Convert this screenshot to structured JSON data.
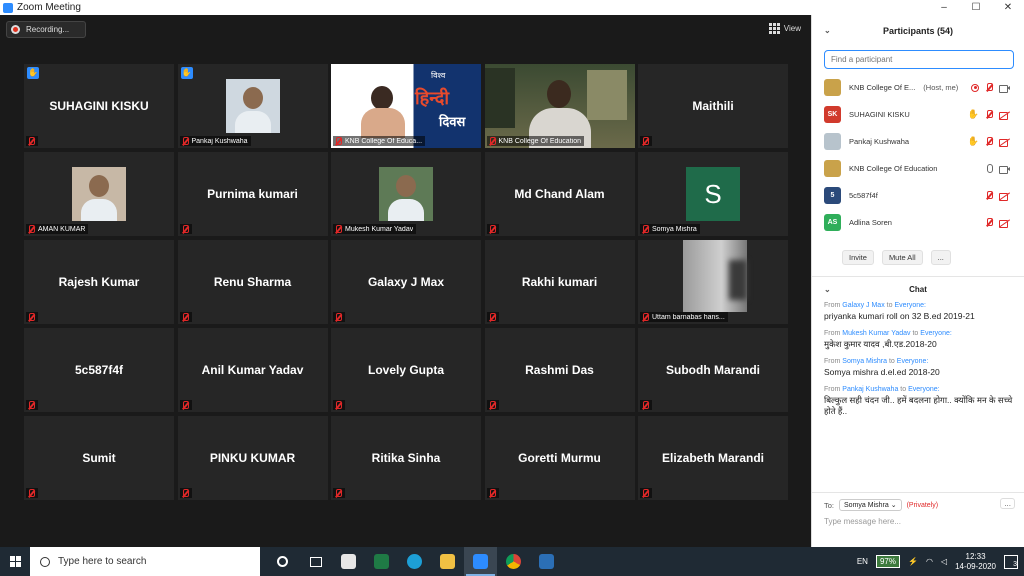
{
  "window": {
    "title": "Zoom Meeting",
    "minimize": "–",
    "maximize": "☐",
    "close": "✕"
  },
  "stage": {
    "recording_label": "Recording...",
    "view_label": "View",
    "tiles": [
      {
        "name": "SUHAGINI KISKU",
        "label": "",
        "hand": true,
        "active": false,
        "kind": "name"
      },
      {
        "name": "",
        "label": "Pankaj Kushwaha",
        "hand": true,
        "active": false,
        "kind": "photo",
        "photo_color": "#cfd8e0"
      },
      {
        "name": "",
        "label": "KNB College Of Educa...",
        "hand": false,
        "active": false,
        "kind": "hindi",
        "hindi_line1": "विश्व",
        "hindi_line2": "हिन्दी",
        "hindi_line3": "दिवस"
      },
      {
        "name": "",
        "label": "KNB College Of Education",
        "hand": false,
        "active": true,
        "kind": "video"
      },
      {
        "name": "Maithili",
        "label": "",
        "hand": false,
        "active": false,
        "kind": "name"
      },
      {
        "name": "",
        "label": "AMAN KUMAR",
        "hand": false,
        "active": false,
        "kind": "photo",
        "photo_color": "#c7b8a6"
      },
      {
        "name": "Purnima kumari",
        "label": "",
        "hand": false,
        "active": false,
        "kind": "name"
      },
      {
        "name": "",
        "label": "Mukesh Kumar Yadav",
        "hand": false,
        "active": false,
        "kind": "photo",
        "photo_color": "#5e7a56"
      },
      {
        "name": "Md Chand Alam",
        "label": "",
        "hand": false,
        "active": false,
        "kind": "name"
      },
      {
        "name": "",
        "label": "Somya Mishra",
        "hand": false,
        "active": false,
        "kind": "avatar",
        "initial": "S"
      },
      {
        "name": "Rajesh Kumar",
        "label": "",
        "hand": false,
        "active": false,
        "kind": "name"
      },
      {
        "name": "Renu Sharma",
        "label": "",
        "hand": false,
        "active": false,
        "kind": "name"
      },
      {
        "name": "Galaxy J Max",
        "label": "",
        "hand": false,
        "active": false,
        "kind": "name"
      },
      {
        "name": "Rakhi kumari",
        "label": "",
        "hand": false,
        "active": false,
        "kind": "name"
      },
      {
        "name": "",
        "label": "Uttam barnabas hans...",
        "hand": false,
        "active": false,
        "kind": "blurry"
      },
      {
        "name": "5c587f4f",
        "label": "",
        "hand": false,
        "active": false,
        "kind": "name"
      },
      {
        "name": "Anil Kumar Yadav",
        "label": "",
        "hand": false,
        "active": false,
        "kind": "name"
      },
      {
        "name": "Lovely Gupta",
        "label": "",
        "hand": false,
        "active": false,
        "kind": "name"
      },
      {
        "name": "Rashmi Das",
        "label": "",
        "hand": false,
        "active": false,
        "kind": "name"
      },
      {
        "name": "Subodh Marandi",
        "label": "",
        "hand": false,
        "active": false,
        "kind": "name"
      },
      {
        "name": "Sumit",
        "label": "",
        "hand": false,
        "active": false,
        "kind": "name"
      },
      {
        "name": "PINKU KUMAR",
        "label": "",
        "hand": false,
        "active": false,
        "kind": "name"
      },
      {
        "name": "Ritika Sinha",
        "label": "",
        "hand": false,
        "active": false,
        "kind": "name"
      },
      {
        "name": "Goretti Murmu",
        "label": "",
        "hand": false,
        "active": false,
        "kind": "name"
      },
      {
        "name": "Elizabeth Marandi",
        "label": "",
        "hand": false,
        "active": false,
        "kind": "name"
      }
    ]
  },
  "participants": {
    "title": "Participants (54)",
    "search_placeholder": "Find a participant",
    "list": [
      {
        "name": "KNB College Of E...",
        "tag": "(Host, me)",
        "avatar": "",
        "avatar_color": "#c9a24a",
        "hand": false,
        "rec": true,
        "mic": "off",
        "cam": "on"
      },
      {
        "name": "SUHAGINI KISKU",
        "tag": "",
        "avatar": "SK",
        "avatar_color": "#d13a2c",
        "hand": true,
        "rec": false,
        "mic": "off",
        "cam": "off"
      },
      {
        "name": "Pankaj Kushwaha",
        "tag": "",
        "avatar": "",
        "avatar_color": "#b7c3cc",
        "hand": true,
        "rec": false,
        "mic": "off",
        "cam": "off"
      },
      {
        "name": "KNB College Of Education",
        "tag": "",
        "avatar": "",
        "avatar_color": "#c9a24a",
        "hand": false,
        "rec": false,
        "mic": "on",
        "cam": "on"
      },
      {
        "name": "5c587f4f",
        "tag": "",
        "avatar": "5",
        "avatar_color": "#2b4a7a",
        "hand": false,
        "rec": false,
        "mic": "off",
        "cam": "off"
      },
      {
        "name": "Adlina Soren",
        "tag": "",
        "avatar": "AS",
        "avatar_color": "#2fae5a",
        "hand": false,
        "rec": false,
        "mic": "off",
        "cam": "off"
      }
    ],
    "invite_label": "Invite",
    "mute_all_label": "Mute All",
    "more_label": "..."
  },
  "chat": {
    "title": "Chat",
    "messages": [
      {
        "from_prefix": "From",
        "sender": "Galaxy J Max",
        "to_word": "to",
        "recipient": "Everyone:",
        "text": "priyanka kumari roll on 32 B.ed 2019-21"
      },
      {
        "from_prefix": "From",
        "sender": "Mukesh Kumar Yadav",
        "to_word": "to",
        "recipient": "Everyone:",
        "text": "मुकेश कुमार यादव ,बी.एड.2018-20"
      },
      {
        "from_prefix": "From",
        "sender": "Somya Mishra",
        "to_word": "to",
        "recipient": "Everyone:",
        "text": "Somya mishra d.el.ed 2018-20"
      },
      {
        "from_prefix": "From",
        "sender": "Pankaj Kushwaha",
        "to_word": "to",
        "recipient": "Everyone:",
        "text": "बिल्कुल सही चंदन जी.. हमें बदलना होगा.. क्योंकि मन के सच्चे होते हैं.."
      }
    ],
    "to_label": "To:",
    "to_value": "Somya Mishra",
    "privately": "(Privately)",
    "more": "...",
    "input_placeholder": "Type message here..."
  },
  "taskbar": {
    "search_placeholder": "Type here to search",
    "lang": "EN",
    "battery": "97%",
    "time": "12:33",
    "date": "14-09-2020",
    "notifications": "3"
  }
}
